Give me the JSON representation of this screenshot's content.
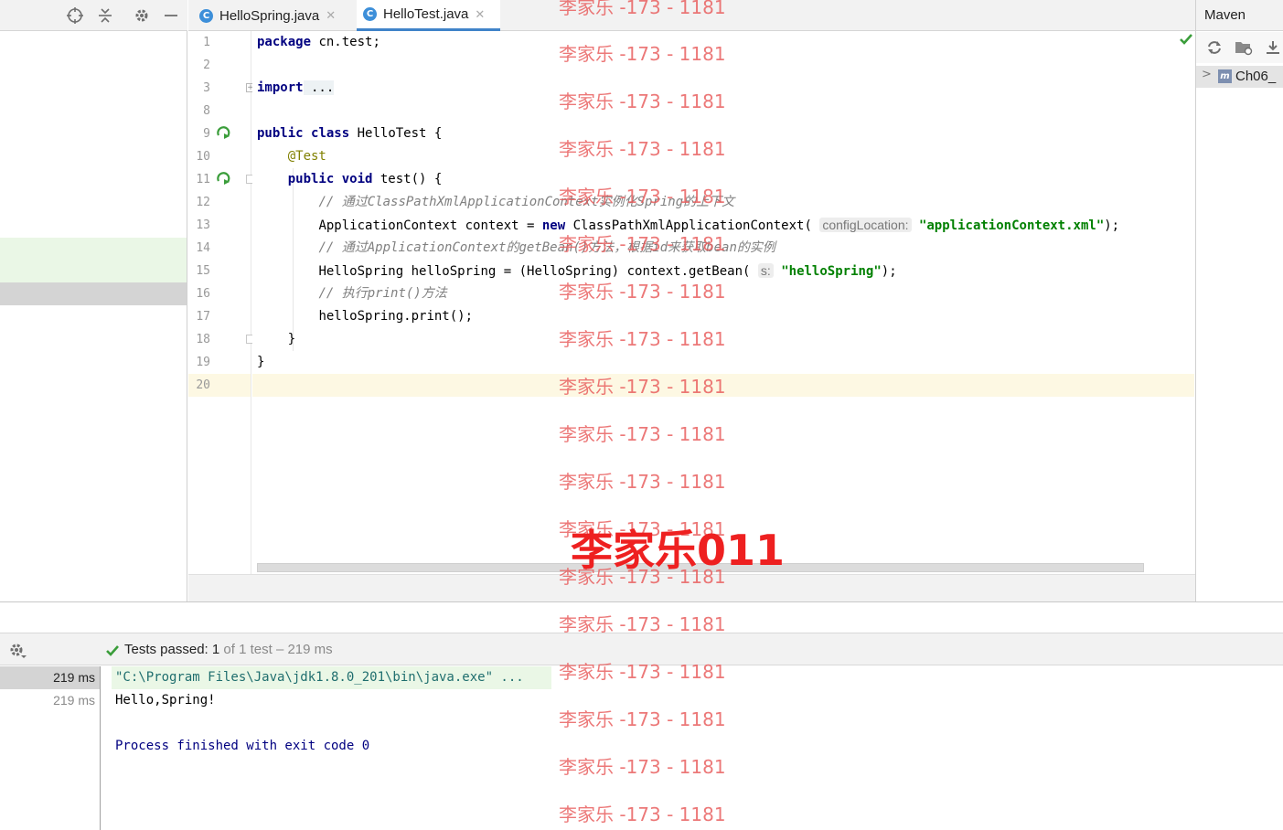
{
  "left_toolbar": {
    "icons": [
      "crosshair-icon",
      "collapse-icon",
      "gear-icon",
      "minimize-icon"
    ]
  },
  "tabs": [
    {
      "label": "HelloSpring.java",
      "icon": "c-class-icon",
      "active": false
    },
    {
      "label": "HelloTest.java",
      "icon": "c-class-icon",
      "active": true
    }
  ],
  "editor": {
    "line_numbers": [
      "1",
      "2",
      "3",
      "8",
      "9",
      "10",
      "11",
      "12",
      "13",
      "14",
      "15",
      "16",
      "17",
      "18",
      "19",
      "20"
    ],
    "current_line": "20",
    "code": {
      "l1_kw": "package",
      "l1_rest": " cn.test;",
      "l3_kw": "import",
      "l3_rest": " ...",
      "l9_kw1": "public",
      "l9_kw2": "class",
      "l9_rest": " HelloTest {",
      "l10_ann": "@Test",
      "l11_kw1": "public",
      "l11_kw2": "void",
      "l11_rest": " test() {",
      "l12_cmt": "// 通过ClassPathXmlApplicationContext实例化Spring的上下文",
      "l13_a": "ApplicationContext context = ",
      "l13_kw": "new",
      "l13_b": " ClassPathXmlApplicationContext(",
      "l13_hint": "configLocation:",
      "l13_str": "\"applicationContext.xml\"",
      "l13_end": ");",
      "l14_cmt": "// 通过ApplicationContext的getBean()方法，根据id来获取bean的实例",
      "l15_a": "HelloSpring helloSpring = (HelloSpring) context.getBean(",
      "l15_hint": "s:",
      "l15_str": "\"helloSpring\"",
      "l15_end": ");",
      "l16_cmt": "// 执行print()方法",
      "l17": "helloSpring.print();",
      "l18": "}",
      "l19": "}"
    }
  },
  "maven": {
    "title": "Maven",
    "project_label": "Ch06_"
  },
  "run": {
    "status_prefix": "Tests passed:",
    "passed_count": "1",
    "status_suffix": "of 1 test – 219 ms",
    "durations": [
      "219 ms",
      "219 ms"
    ],
    "console_lines": [
      "\"C:\\Program Files\\Java\\jdk1.8.0_201\\bin\\java.exe\" ...",
      "Hello,Spring!",
      "",
      "Process finished with exit code 0"
    ]
  },
  "watermark": {
    "repeat_text": "李家乐 -173 - 1181",
    "big_text": "李家乐011"
  },
  "colors": {
    "keyword": "#000080",
    "annotation": "#808000",
    "comment": "#808080",
    "string": "#008000",
    "current_line": "#fdf8e3",
    "diff_added": "#eaf7e6",
    "watermark": "#e85a5a",
    "pass_green": "#3a9d3a"
  }
}
